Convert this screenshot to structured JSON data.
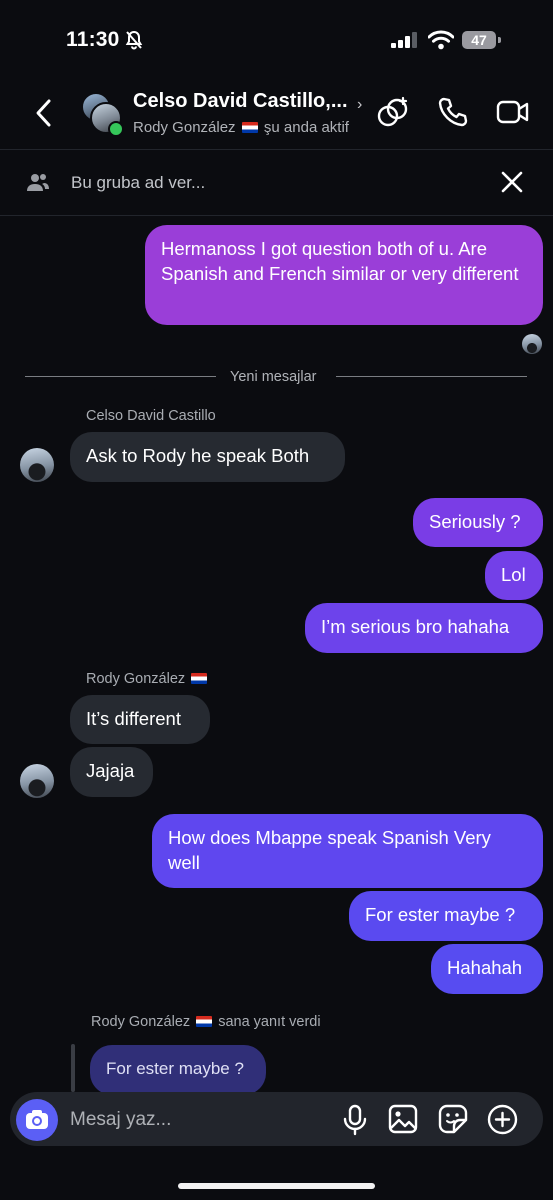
{
  "status_bar": {
    "time": "11:30",
    "battery": "47"
  },
  "header": {
    "title": "Celso David Castillo,...",
    "subtitle_name": "Rody González",
    "subtitle_status": "şu anda aktif"
  },
  "name_group": {
    "placeholder": "Bu gruba ad ver..."
  },
  "messages": {
    "m1": "Hermanoss I got question both of u. Are Spanish and French similar or very different",
    "new_messages_label": "Yeni mesajlar",
    "sender1": "Celso David Castillo",
    "m2": "Ask to Rody he speak Both",
    "m3": "Seriously ?",
    "m4": "Lol",
    "m5": "I’m serious bro hahaha",
    "sender2": "Rody González",
    "m6": "It’s different",
    "m7": "Jajaja",
    "m8": "How does Mbappe speak Spanish Very well",
    "m9": "For ester maybe ?",
    "m10": "Hahahah",
    "reply_header_name": "Rody González",
    "reply_header_text": "sana yanıt verdi",
    "m11_quoted": "For ester maybe ?"
  },
  "composer": {
    "placeholder": "Mesaj yaz..."
  },
  "icons": [
    "camera-icon",
    "microphone-icon",
    "gallery-icon",
    "sticker-icon",
    "plus-icon",
    "back-icon",
    "video-call-icon",
    "phone-icon",
    "effects-icon",
    "close-icon",
    "people-icon",
    "bell-muted-icon",
    "signal-icon",
    "wifi-icon",
    "battery-icon"
  ],
  "colors": {
    "background": "#0b0c10",
    "incoming": "#262a31",
    "outgoing_top": "#9b3fd6",
    "outgoing_bottom": "#5b4df2",
    "online": "#35c75a"
  }
}
